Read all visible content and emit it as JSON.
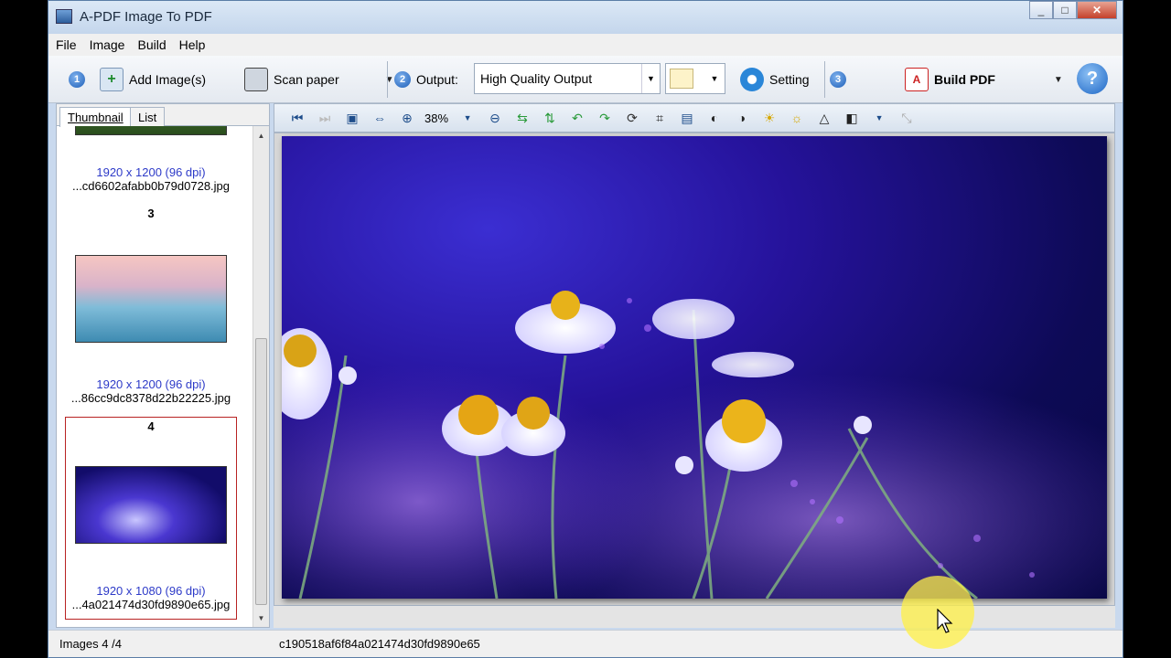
{
  "window": {
    "title": "A-PDF Image To PDF",
    "min": "_",
    "max": "□",
    "close": "✕"
  },
  "menu": [
    "File",
    "Image",
    "Build",
    "Help"
  ],
  "toolbar": {
    "step1": "1",
    "add_images": "Add Image(s)",
    "scan": "Scan paper",
    "step2": "2",
    "output_label": "Output:",
    "output_value": "High Quality Output",
    "setting": "Setting",
    "step3": "3",
    "build_pdf": "Build PDF",
    "help": "?"
  },
  "tabs": {
    "thumbnail": "Thumbnail",
    "list": "List"
  },
  "thumbnails": [
    {
      "dims": "1920 x 1200 (96 dpi)",
      "fname": "...cd6602afabb0b79d0728.jpg"
    },
    {
      "num": "3",
      "dims": "1920 x 1200 (96 dpi)",
      "fname": "...86cc9dc8378d22b22225.jpg"
    },
    {
      "num": "4",
      "dims": "1920 x 1080 (96 dpi)",
      "fname": "...4a021474d30fd9890e65.jpg"
    }
  ],
  "viewer": {
    "zoom": "38%"
  },
  "status": {
    "images": "Images 4 /4",
    "file": "c190518af6f84a021474d30fd9890e65"
  }
}
